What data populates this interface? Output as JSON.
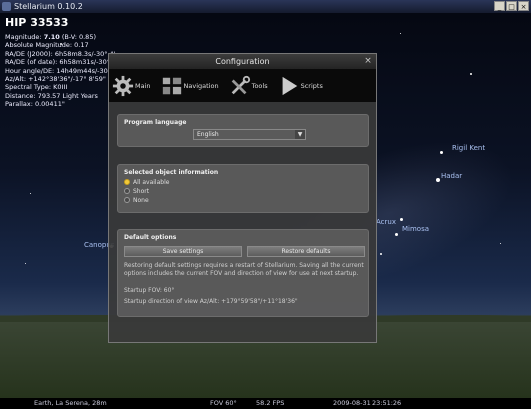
{
  "window": {
    "title": "Stellarium 0.10.2",
    "buttons": [
      "_",
      "□",
      "×"
    ]
  },
  "object_info": {
    "name": "HIP 33533",
    "magnitude_label": "Magnitude:",
    "magnitude_value": "7.10",
    "magnitude_bv": "(B-V: 0.85)",
    "lines": [
      "Absolute Magnitude: 0.17",
      "RA/DE (J2000): 6h58m8.3s/-30° 4'",
      "RA/DE (of date): 6h58m31s/-30°4'",
      "Hour angle/DE: 14h49m44s/-30°4'",
      "Az/Alt: +142°38'36\"/-17° 8'59\"",
      "Spectral Type: K0III",
      "Distance: 793.57 Light Years",
      "Parallax: 0.00411\""
    ]
  },
  "sky_labels": {
    "canopus": "Canopus",
    "acrux": "Acrux",
    "mimosa": "Mimosa",
    "hadar": "Hadar",
    "rigil": "Rigil Kent"
  },
  "dialog": {
    "title": "Configuration",
    "close": "×",
    "tabs": [
      {
        "label": "Main",
        "icon": "gear-icon"
      },
      {
        "label": "Navigation",
        "icon": "navigation-icon"
      },
      {
        "label": "Tools",
        "icon": "tools-icon"
      },
      {
        "label": "Scripts",
        "icon": "play-icon"
      }
    ],
    "program_language": {
      "title": "Program language",
      "selected": "English"
    },
    "object_information": {
      "title": "Selected object information",
      "options": [
        {
          "label": "All available",
          "selected": true
        },
        {
          "label": "Short",
          "selected": false
        },
        {
          "label": "None",
          "selected": false
        }
      ]
    },
    "default_options": {
      "title": "Default options",
      "save_label": "Save settings",
      "restore_label": "Restore defaults",
      "restart_note": "Restoring default settings requires a restart of Stellarium. Saving all the current options includes the current FOV and direction of view for use at next startup.",
      "startup_fov": "Startup FOV: 60°",
      "startup_direction": "Startup direction of view Az/Alt: +179°59'58\"/+11°18'36\""
    }
  },
  "status": {
    "location": "Earth, La Serena, 28m",
    "fov": "FOV 60°",
    "fps": "58.2 FPS",
    "date": "2009-08-31",
    "time": "23:51:26"
  }
}
